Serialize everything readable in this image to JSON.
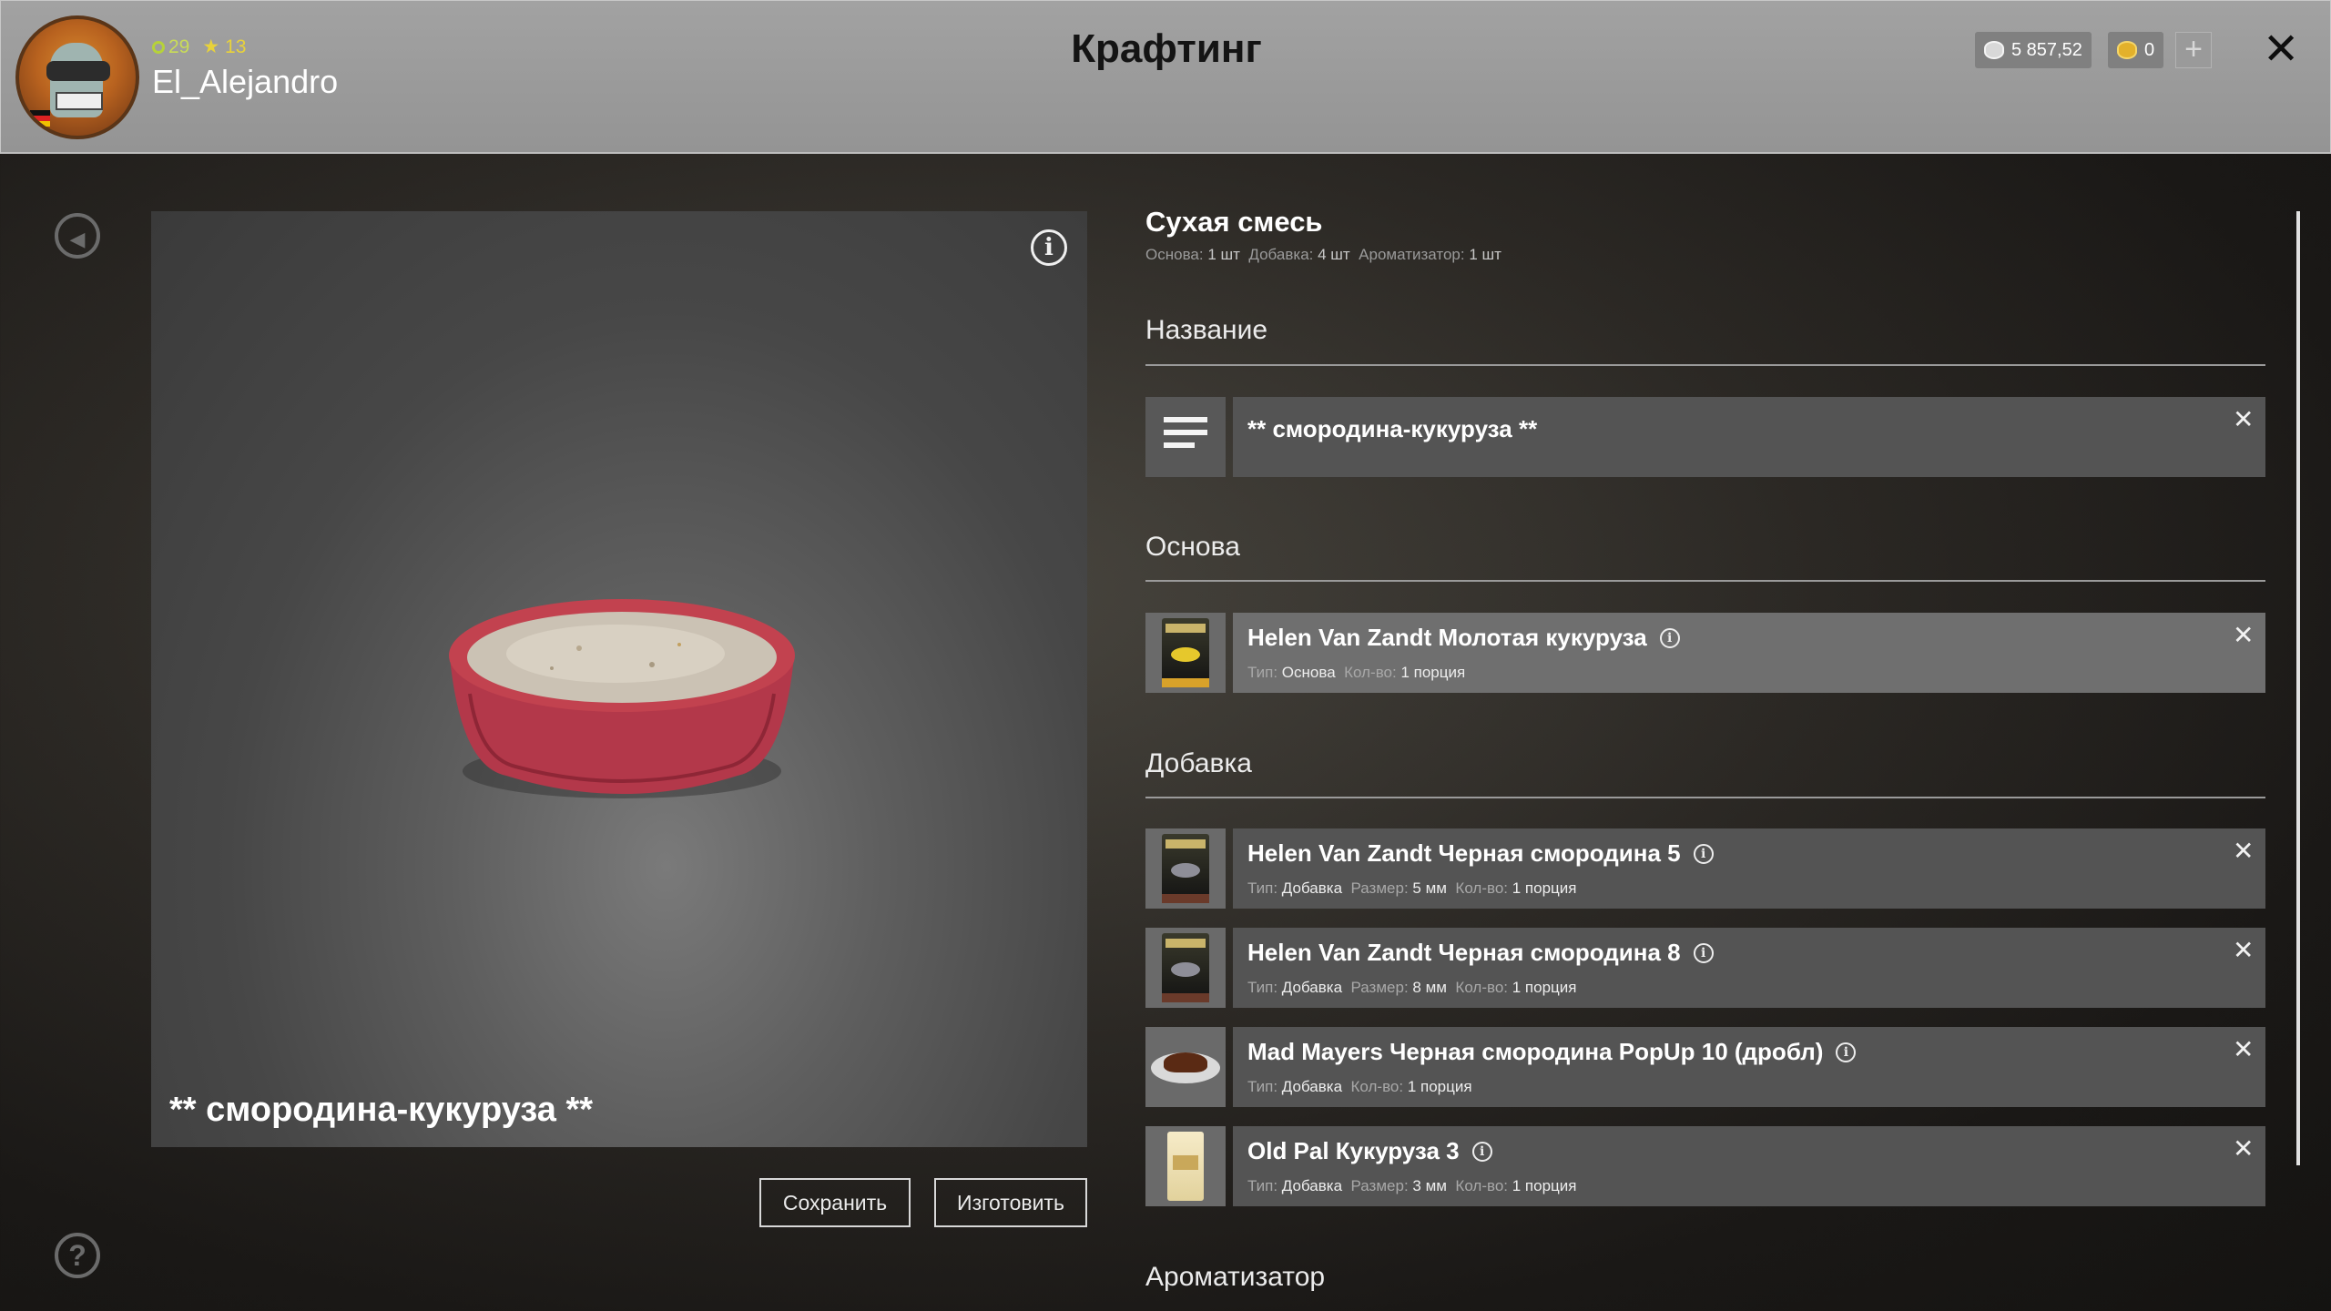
{
  "header": {
    "title": "Крафтинг",
    "level": "29",
    "rank": "13",
    "username": "El_Alejandro",
    "silver": "5 857,52",
    "gold": "0",
    "add_label": "+",
    "close_label": "✕"
  },
  "preview": {
    "info_label": "i",
    "name": "** смородина-кукуруза **"
  },
  "actions": {
    "save_label": "Сохранить",
    "craft_label": "Изготовить"
  },
  "recipe": {
    "title": "Сухая смесь",
    "summary": [
      {
        "label": "Основа:",
        "value": "1 шт"
      },
      {
        "label": "Добавка:",
        "value": "4 шт"
      },
      {
        "label": "Ароматизатор:",
        "value": "1 шт"
      }
    ]
  },
  "sections": {
    "name": {
      "heading": "Название",
      "value": "** смородина-кукуруза **"
    },
    "base": {
      "heading": "Основа",
      "items": [
        {
          "title": "Helen Van Zandt Молотая кукуруза",
          "type_label": "Тип:",
          "type": "Основа",
          "size_label": "",
          "size": "",
          "qty_label": "Кол-во:",
          "qty": "1 порция"
        }
      ]
    },
    "additive": {
      "heading": "Добавка",
      "items": [
        {
          "title": "Helen Van Zandt Черная смородина 5",
          "type_label": "Тип:",
          "type": "Добавка",
          "size_label": "Размер:",
          "size": "5 мм",
          "qty_label": "Кол-во:",
          "qty": "1 порция"
        },
        {
          "title": "Helen Van Zandt Черная смородина 8",
          "type_label": "Тип:",
          "type": "Добавка",
          "size_label": "Размер:",
          "size": "8 мм",
          "qty_label": "Кол-во:",
          "qty": "1 порция"
        },
        {
          "title": "Mad Mayers Черная смородина PopUp 10 (дробл)",
          "type_label": "Тип:",
          "type": "Добавка",
          "size_label": "",
          "size": "",
          "qty_label": "Кол-во:",
          "qty": "1 порция"
        },
        {
          "title": "Old Pal Кукуруза 3",
          "type_label": "Тип:",
          "type": "Добавка",
          "size_label": "Размер:",
          "size": "3 мм",
          "qty_label": "Кол-во:",
          "qty": "1 порция"
        }
      ]
    },
    "flavor": {
      "heading": "Ароматизатор"
    }
  },
  "icons": {
    "back": "back-arrow-icon",
    "help": "help-icon",
    "info": "info-icon",
    "remove": "close-icon",
    "name": "lines-icon"
  },
  "colors": {
    "header_bg": "#9b9b9b",
    "row_bg": "#545454",
    "row_highlight": "#6f6f6f",
    "level_green": "#c9dc58",
    "rank_yellow": "#e8d23a"
  }
}
